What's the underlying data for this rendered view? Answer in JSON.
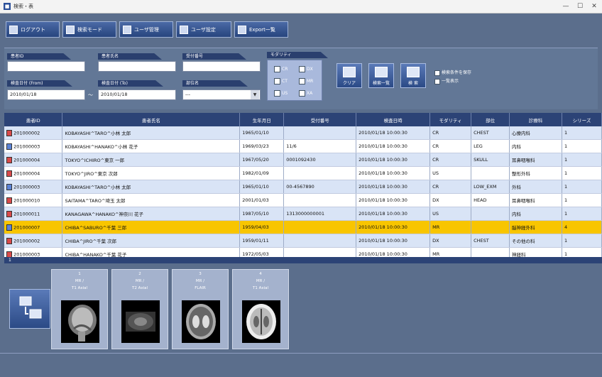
{
  "window": {
    "title": "検索・表",
    "min": "—",
    "max": "☐",
    "close": "✕"
  },
  "toolbar": {
    "buttons": [
      {
        "label": "ログアウト",
        "icon": "logout-icon"
      },
      {
        "label": "検索モード",
        "icon": "search-mode-icon"
      },
      {
        "label": "ユーザ管理",
        "icon": "user-admin-icon"
      },
      {
        "label": "ユーザ設定",
        "icon": "wrench-icon"
      },
      {
        "label": "Export一覧",
        "icon": "export-icon"
      }
    ]
  },
  "search": {
    "patient_id_label": "患者ID",
    "patient_name_label": "患者氏名",
    "accession_label": "受付番号",
    "date_from_label": "検査日付 (From)",
    "date_from_value": "2010/01/18",
    "date_to_label": "検査日付 (To)",
    "date_to_value": "2010/01/18",
    "date_sep": "〜",
    "bodypart_label": "部位名",
    "bodypart_value": "---",
    "modality_label": "モダリティ",
    "modalities": [
      "CR",
      "DX",
      "CT",
      "MR",
      "US",
      "XA"
    ],
    "buttons": [
      {
        "label": "クリア"
      },
      {
        "label": "検索一覧"
      },
      {
        "label": "検 索"
      }
    ],
    "options": [
      "検索条件を保存",
      "一覧表示"
    ]
  },
  "grid": {
    "columns": [
      "患者ID",
      "患者氏名",
      "生年月日",
      "受付番号",
      "検査日時",
      "モダリティ",
      "部位",
      "診療科",
      "シリーズ"
    ],
    "rows": [
      [
        "201000002",
        "KOBAYASHI^TARO^小林 太郎",
        "1965/01/10",
        "",
        "2010/01/18 10:00:30",
        "CR",
        "CHEST",
        "心療内科",
        "1"
      ],
      [
        "201000003",
        "KOBAYASHI^HANAKO^小林 花子",
        "1969/03/23",
        "11/6",
        "2010/01/18 10:00:30",
        "CR",
        "LEG",
        "内科",
        "1"
      ],
      [
        "201000004",
        "TOKYO^ICHIRO^東京 一郎",
        "1967/05/20",
        "0001092430",
        "2010/01/18 10:00:30",
        "CR",
        "SKULL",
        "耳鼻咽喉科",
        "1"
      ],
      [
        "201000004",
        "TOKYO^JIRO^東京 次郎",
        "1982/01/09",
        "",
        "2010/01/18 10:00:30",
        "US",
        "",
        "整形外科",
        "1"
      ],
      [
        "201000003",
        "KOBAYASHI^TARO^小林 太郎",
        "1965/01/10",
        "00-4567890",
        "2010/01/18 10:00:30",
        "CR",
        "LOW_EXM",
        "外科",
        "1"
      ],
      [
        "201000010",
        "SAITAMA^TARO^埼玉 太郎",
        "2001/01/03",
        "",
        "2010/01/18 10:00:30",
        "DX",
        "HEAD",
        "耳鼻咽喉科",
        "1"
      ],
      [
        "201000011",
        "KANAGAWA^HANAKO^神奈川 花子",
        "1987/05/10",
        "1313000000001",
        "2010/01/18 10:00:30",
        "US",
        "",
        "内科",
        "1"
      ],
      [
        "201000007",
        "CHIBA^SABURO^千葉 三郎",
        "1959/04/03",
        "",
        "2010/01/18 10:00:30",
        "MR",
        "",
        "脳神経外科",
        "4"
      ],
      [
        "201000002",
        "CHIBA^JIRO^千葉 次郎",
        "1959/01/11",
        "",
        "2010/01/18 10:00:30",
        "DX",
        "CHEST",
        "その他の科",
        "1"
      ],
      [
        "201000003",
        "CHIBA^HANAKO^千葉 花子",
        "1972/05/03",
        "",
        "2010/01/18 10:00:30",
        "MR",
        "",
        "神経科",
        "1"
      ]
    ],
    "selected_row": 7,
    "footer": "1"
  },
  "thumbnails": [
    {
      "cap1": "1",
      "cap2": "MR /",
      "cap3": "T1 Axial",
      "img": "sagittal"
    },
    {
      "cap1": "2",
      "cap2": "MR /",
      "cap3": "T2 Axial",
      "img": "axial-dark"
    },
    {
      "cap1": "3",
      "cap2": "MR /",
      "cap3": "FLAIR",
      "img": "axial-mid"
    },
    {
      "cap1": "4",
      "cap2": "MR /",
      "cap3": "T1 Axial",
      "img": "axial-bright"
    }
  ],
  "colors": {
    "header": "#2c4376",
    "selected": "#f8c500",
    "toolbar_bg": "#5b6e8c"
  }
}
